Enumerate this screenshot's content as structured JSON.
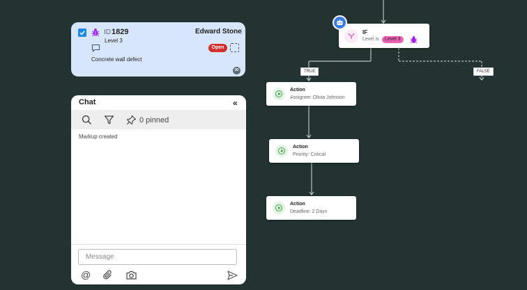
{
  "markup_card": {
    "checked": true,
    "bug_icon": "bug-icon",
    "id_label": "ID",
    "id_value": "1829",
    "owner": "Edward Stone",
    "level": "Level 3",
    "status": "Open",
    "status_color": "#d32f2f",
    "description": "Concrete wall defect",
    "badge": "3D"
  },
  "chat": {
    "title": "Chat",
    "collapse_glyph": "«",
    "pinned_label": "0 pinned",
    "messages": [
      "Markup created"
    ],
    "input_placeholder": "Message",
    "input_value": ""
  },
  "workflow": {
    "if_node": {
      "title": "IF",
      "condition_prefix": "Level is",
      "condition_value": "Level 3",
      "condition_color": "#ec61b4"
    },
    "branch_true": "TRUE",
    "branch_false": "FALSE",
    "actions": [
      {
        "title": "Action",
        "detail": "Assignee: Olivia Johnson"
      },
      {
        "title": "Action",
        "detail": "Priority: Critical"
      },
      {
        "title": "Action",
        "detail": "Deadline: 2 Days"
      }
    ]
  },
  "colors": {
    "background": "#223331",
    "card": "#d7e6fb",
    "accent": "#1e88e5",
    "action_green": "#43a047",
    "bug_purple": "#a020f0"
  }
}
